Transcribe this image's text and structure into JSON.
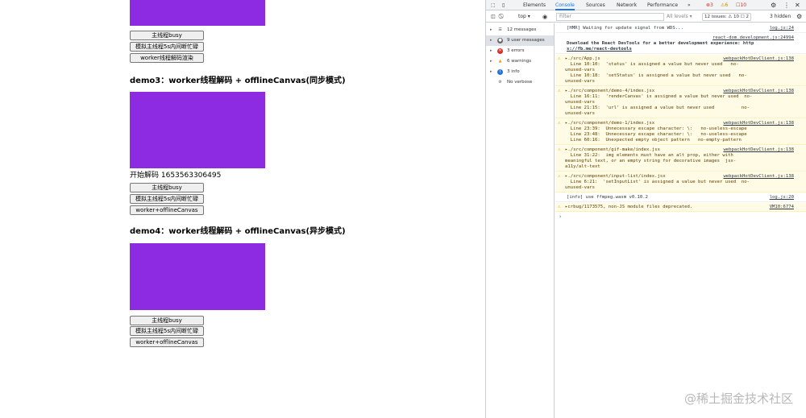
{
  "page": {
    "demo2_buttons": [
      "主线程busy",
      "模拟主线程5s内间断忙碌",
      "worker线程解码渲染"
    ],
    "demo3": {
      "heading": "demo3：worker线程解码 + offlineCanvas(同步模式)",
      "status": "开始解码 1653563306495",
      "buttons": [
        "主线程busy",
        "模拟主线程5s内间断忙碌",
        "worker+offlineCanvas"
      ]
    },
    "demo4": {
      "heading": "demo4：worker线程解码 + offlineCanvas(异步模式)",
      "buttons": [
        "主线程busy",
        "模拟主线程5s内间断忙碌",
        "worker+offlineCanvas"
      ]
    },
    "canvas_color": "#8c2be2",
    "watermark": "@稀土掘金技术社区"
  },
  "devtools": {
    "tabs": [
      "Elements",
      "Console",
      "Sources",
      "Network",
      "Performance"
    ],
    "more_tabs": "»",
    "badges": {
      "errors": "3",
      "warnings": "6",
      "issues": "10"
    },
    "toolbar": {
      "context": "top ▾",
      "filter_placeholder": "Filter",
      "levels": "All levels ▾",
      "issues_pill": "12 issues: ⚠ 10  ☐ 2",
      "hidden": "3 hidden"
    },
    "sidebar": [
      {
        "label": "12 messages",
        "icon": "list-icon"
      },
      {
        "label": "9 user messages",
        "icon": "user-icon",
        "selected": true
      },
      {
        "label": "3 errors",
        "icon": "error-icon"
      },
      {
        "label": "6 warnings",
        "icon": "warning-icon"
      },
      {
        "label": "3 info",
        "icon": "info-icon"
      },
      {
        "label": "No verbose",
        "icon": "gear-icon"
      }
    ],
    "messages": [
      {
        "type": "log",
        "lines": [
          "[HMR] Waiting for update signal from WDS..."
        ],
        "source": "log.js:24"
      },
      {
        "type": "log",
        "lines": [
          "",
          "Download the React DevTools for a better development experience: http",
          "s://fb.me/react-devtools"
        ],
        "source": "react-dom.development.js:24994"
      },
      {
        "type": "warn",
        "lines": [
          "▸./src/App.js",
          "  Line 10:10:  'status' is assigned a value but never used   no-",
          "unused-vars",
          "  Line 10:18:  'setStatus' is assigned a value but never used   no-",
          "unused-vars"
        ],
        "source": "webpackHotDevClient.js:138"
      },
      {
        "type": "warn",
        "lines": [
          "▸./src/component/demo-4/index.jsx",
          "  Line 16:11:  'renderCanvas' is assigned a value but never used  no-",
          "unused-vars",
          "  Line 21:15:  'url' is assigned a value but never used          no-",
          "unused-vars"
        ],
        "source": "webpackHotDevClient.js:138"
      },
      {
        "type": "warn",
        "lines": [
          "▸./src/component/demo-1/index.jsx",
          "  Line 23:39:  Unnecessary escape character: \\:   no-useless-escape",
          "  Line 23:48:  Unnecessary escape character: \\:   no-useless-escape",
          "  Line 60:16:  Unexpected empty object pattern   no-empty-pattern"
        ],
        "source": "webpackHotDevClient.js:138"
      },
      {
        "type": "warn",
        "lines": [
          "▸./src/component/gif-make/index.jsx",
          "  Line 31:22:  img elements must have an alt prop, either with",
          "meaningful text, or an empty string for decorative images  jsx-",
          "a11y/alt-text"
        ],
        "source": "webpackHotDevClient.js:138"
      },
      {
        "type": "warn",
        "lines": [
          "▸./src/component/input-list/index.jsx",
          "  Line 6:21:  'setInputList' is assigned a value but never used  no-",
          "unused-vars"
        ],
        "source": "webpackHotDevClient.js:138"
      },
      {
        "type": "log",
        "lines": [
          "[info] use ffmpeg.wasm v0.10.2"
        ],
        "source": "log.js:20"
      },
      {
        "type": "warn",
        "lines": [
          "▸crbug/1173575, non-JS module files deprecated."
        ],
        "source": "VM10:6774"
      }
    ],
    "prompt": "›"
  }
}
